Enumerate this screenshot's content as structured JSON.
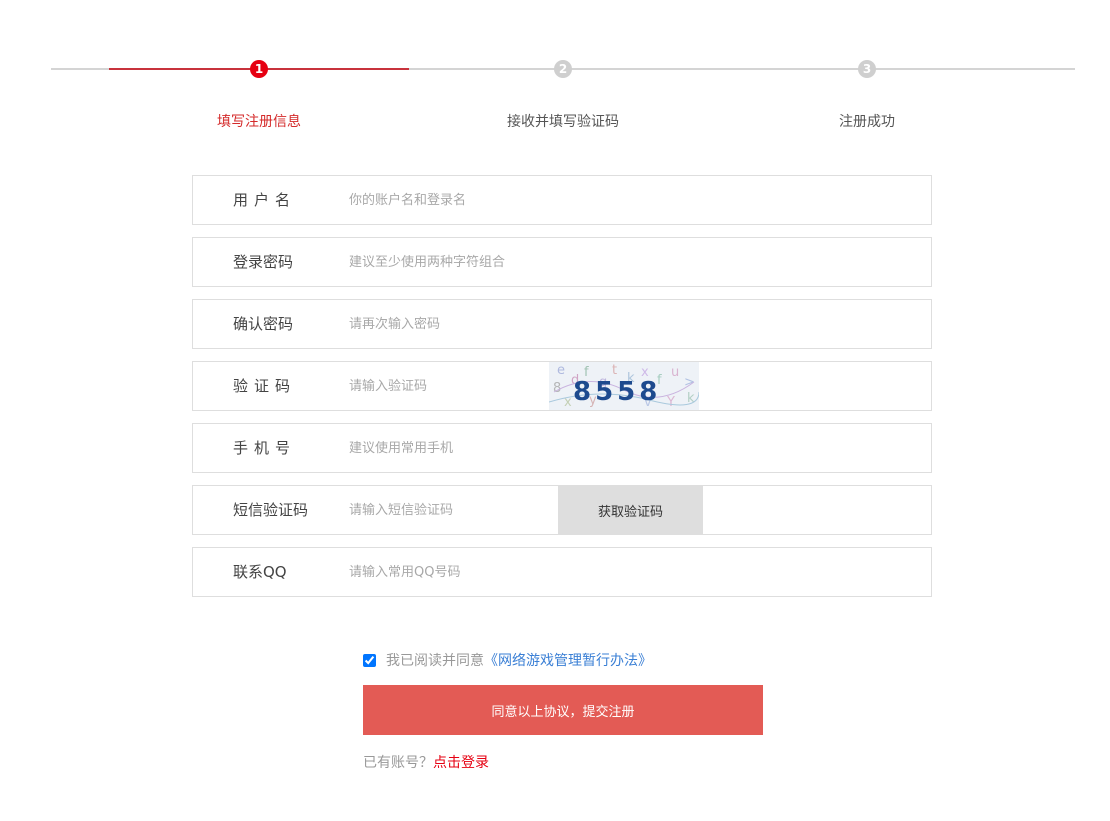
{
  "steps": [
    {
      "number": "1",
      "label": "填写注册信息",
      "state": "active"
    },
    {
      "number": "2",
      "label": "接收并填写验证码",
      "state": "pending"
    },
    {
      "number": "3",
      "label": "注册成功",
      "state": "pending"
    }
  ],
  "form": {
    "username": {
      "label": "用户名",
      "placeholder": "你的账户名和登录名",
      "value": ""
    },
    "password": {
      "label": "登录密码",
      "placeholder": "建议至少使用两种字符组合",
      "value": ""
    },
    "confirm_password": {
      "label": "确认密码",
      "placeholder": "请再次输入密码",
      "value": ""
    },
    "captcha": {
      "label": "验证码",
      "placeholder": "请输入验证码",
      "value": "",
      "image_text": "8558"
    },
    "phone": {
      "label": "手机号",
      "placeholder": "建议使用常用手机",
      "value": ""
    },
    "sms_code": {
      "label": "短信验证码",
      "placeholder": "请输入短信验证码",
      "value": "",
      "button_label": "获取验证码"
    },
    "qq": {
      "label": "联系QQ",
      "placeholder": "请输入常用QQ号码",
      "value": ""
    }
  },
  "agreement": {
    "checked": true,
    "text": "我已阅读并同意",
    "link_text": "《网络游戏管理暂行办法》"
  },
  "submit": {
    "label": "同意以上协议，提交注册"
  },
  "login": {
    "prompt": "已有账号？",
    "link_text": "点击登录"
  },
  "colors": {
    "accent_red": "#e60012",
    "submit_bg": "#e35b55",
    "link_blue": "#3a7fd5",
    "border": "#dedede"
  }
}
